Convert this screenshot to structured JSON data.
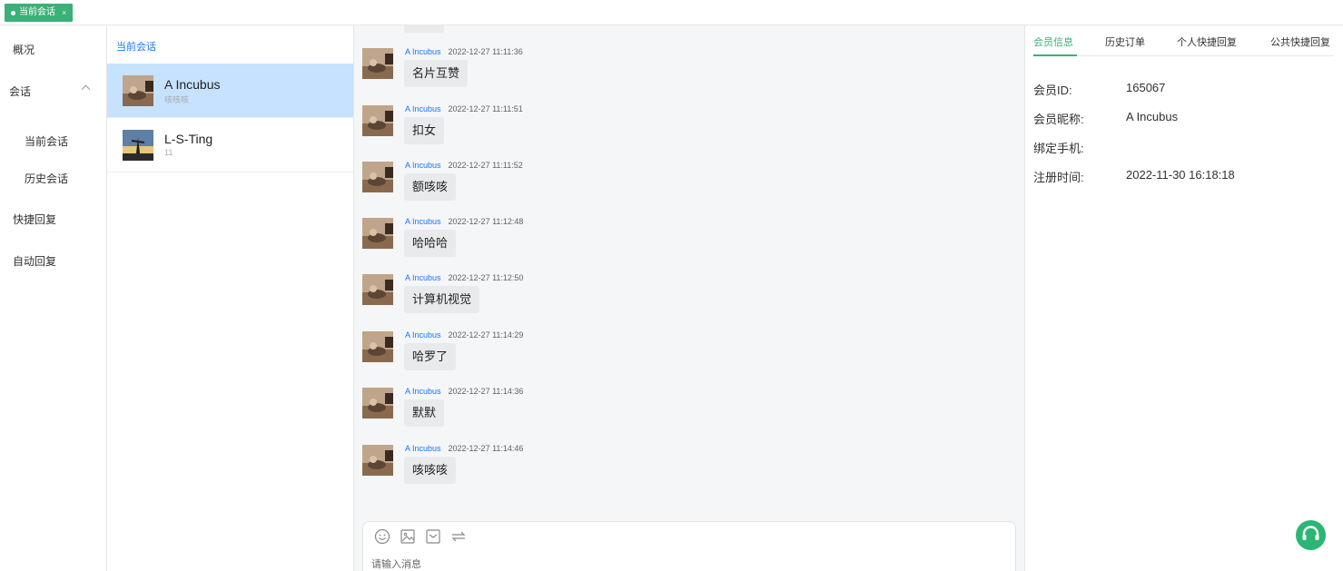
{
  "tagbar": {
    "tag_label": "当前会话",
    "close_glyph": "×"
  },
  "nav": {
    "overview": "概况",
    "sessions": "会话",
    "current_sessions": "当前会话",
    "history_sessions": "历史会话",
    "quick_reply": "快捷回复",
    "auto_reply": "自动回复"
  },
  "conversations": {
    "title": "当前会话",
    "items": [
      {
        "name": "A Incubus",
        "preview": "咳咳咳",
        "active": true
      },
      {
        "name": "L-S-Ting",
        "preview": "11",
        "active": false
      }
    ]
  },
  "chat": {
    "messages": [
      {
        "sender": "A Incubus",
        "time": "2022-12-27 11:11:36",
        "text": "名片互赞"
      },
      {
        "sender": "A Incubus",
        "time": "2022-12-27 11:11:51",
        "text": "扣女"
      },
      {
        "sender": "A Incubus",
        "time": "2022-12-27 11:11:52",
        "text": "额咳咳"
      },
      {
        "sender": "A Incubus",
        "time": "2022-12-27 11:12:48",
        "text": "哈哈哈"
      },
      {
        "sender": "A Incubus",
        "time": "2022-12-27 11:12:50",
        "text": "计算机视觉"
      },
      {
        "sender": "A Incubus",
        "time": "2022-12-27 11:14:29",
        "text": "哈罗了"
      },
      {
        "sender": "A Incubus",
        "time": "2022-12-27 11:14:36",
        "text": "默默"
      },
      {
        "sender": "A Incubus",
        "time": "2022-12-27 11:14:46",
        "text": "咳咳咳"
      }
    ],
    "input_placeholder": "请输入消息",
    "tool_icons": [
      "emoji-icon",
      "image-icon",
      "order-card-icon",
      "transfer-icon"
    ]
  },
  "panel": {
    "tabs": [
      "会员信息",
      "历史订单",
      "个人快捷回复",
      "公共快捷回复"
    ],
    "active_tab": 0,
    "fields": [
      {
        "label": "会员ID:",
        "value": "165067"
      },
      {
        "label": "会员昵称:",
        "value": "A Incubus"
      },
      {
        "label": "绑定手机:",
        "value": ""
      },
      {
        "label": "注册时间:",
        "value": "2022-11-30 16:18:18"
      }
    ]
  },
  "colors": {
    "accent_green": "#3bb077",
    "link_blue": "#1677ff",
    "active_row": "#c6e2ff"
  }
}
